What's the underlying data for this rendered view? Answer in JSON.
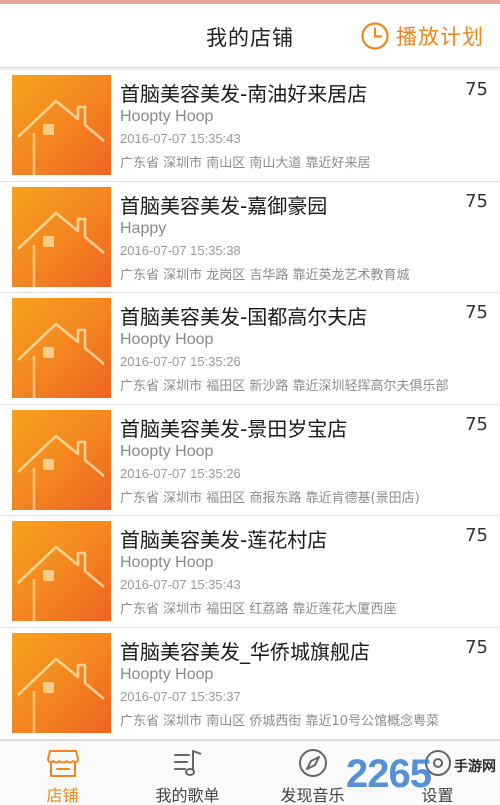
{
  "header": {
    "title": "我的店铺",
    "schedule_label": "播放计划",
    "schedule_icon": "clock-icon",
    "accent_color": "#f0861c"
  },
  "stores": [
    {
      "name": "首脑美容美发-南油好来居店",
      "count": "75",
      "subtitle": "Hoopty Hoop",
      "time": "2016-07-07 15:35:43",
      "address": "广东省 深圳市 南山区 南山大道 靠近好来居"
    },
    {
      "name": "首脑美容美发-嘉御豪园",
      "count": "75",
      "subtitle": "Happy",
      "time": "2016-07-07 15:35:38",
      "address": "广东省 深圳市 龙岗区 吉华路 靠近英龙艺术教育城"
    },
    {
      "name": "首脑美容美发-国都高尔夫店",
      "count": "75",
      "subtitle": "Hoopty Hoop",
      "time": "2016-07-07 15:35:26",
      "address": "广东省 深圳市 福田区 新沙路 靠近深圳轻挥高尔夫俱乐部"
    },
    {
      "name": "首脑美容美发-景田岁宝店",
      "count": "75",
      "subtitle": "Hoopty Hoop",
      "time": "2016-07-07 15:35:26",
      "address": "广东省 深圳市 福田区 商报东路 靠近肯德基(景田店)"
    },
    {
      "name": "首脑美容美发-莲花村店",
      "count": "75",
      "subtitle": "Hoopty Hoop",
      "time": "2016-07-07 15:35:43",
      "address": "广东省 深圳市 福田区 红荔路 靠近莲花大厦西座"
    },
    {
      "name": "首脑美容美发_华侨城旗舰店",
      "count": "75",
      "subtitle": "Hoopty Hoop",
      "time": "2016-07-07 15:35:37",
      "address": "广东省 深圳市 南山区 侨城西街 靠近10号公馆概念粤菜"
    }
  ],
  "tabs": [
    {
      "label": "店铺",
      "icon": "store-icon",
      "active": true
    },
    {
      "label": "我的歌单",
      "icon": "playlist-icon",
      "active": false
    },
    {
      "label": "发现音乐",
      "icon": "compass-icon",
      "active": false
    },
    {
      "label": "设置",
      "icon": "settings-icon",
      "active": false
    }
  ],
  "watermark": {
    "number": "2265",
    "text": "手游网"
  }
}
